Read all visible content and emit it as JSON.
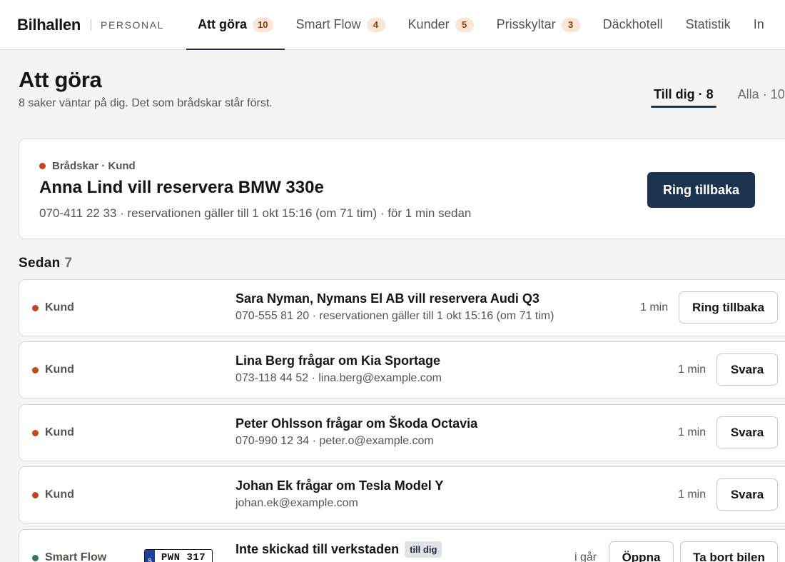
{
  "brand": {
    "name": "Bilhallen",
    "sub": "PERSONAL"
  },
  "nav": {
    "tabs": [
      {
        "label": "Att göra",
        "badge": "10",
        "active": true
      },
      {
        "label": "Smart Flow",
        "badge": "4"
      },
      {
        "label": "Kunder",
        "badge": "5"
      },
      {
        "label": "Prisskyltar",
        "badge": "3"
      },
      {
        "label": "Däckhotell"
      },
      {
        "label": "Statistik"
      },
      {
        "label": "In"
      }
    ]
  },
  "page": {
    "title": "Att göra",
    "subtitle": "8 saker väntar på dig. Det som brådskar står först."
  },
  "filters": [
    {
      "label": "Till dig · 8",
      "active": true
    },
    {
      "label": "Alla · 10"
    }
  ],
  "urgent": {
    "tag": "Brådskar · Kund",
    "title": "Anna Lind vill reservera BMW 330e",
    "meta": "070-411 22 33 · reservationen gäller till 1 okt 15:16 (om 71 tim) · för 1 min sedan",
    "action": "Ring tillbaka"
  },
  "section": {
    "label": "Sedan",
    "count": "7"
  },
  "rows": [
    {
      "tag": "Kund",
      "title": "Sara Nyman, Nymans El AB vill reservera Audi Q3",
      "meta": "070-555 81 20 · reservationen gäller till 1 okt 15:16 (om 71 tim)",
      "time": "1 min",
      "action": "Ring tillbaka"
    },
    {
      "tag": "Kund",
      "title": "Lina Berg frågar om Kia Sportage",
      "meta": "073-118 44 52 · lina.berg@example.com",
      "time": "1 min",
      "action": "Svara"
    },
    {
      "tag": "Kund",
      "title": "Peter Ohlsson frågar om Škoda Octavia",
      "meta": "070-990 12 34 · peter.o@example.com",
      "time": "1 min",
      "action": "Svara"
    },
    {
      "tag": "Kund",
      "title": "Johan Ek frågar om Tesla Model Y",
      "meta": "johan.ek@example.com",
      "time": "1 min",
      "action": "Svara"
    },
    {
      "tag": "Smart Flow",
      "plate": {
        "country": "S",
        "number": "PWN 317"
      },
      "title": "Inte skickad till verkstaden",
      "pill": "till dig",
      "time": "i går",
      "action": "Öppna",
      "action2": "Ta bort bilen"
    }
  ],
  "colors": {
    "primary": "#1c3450",
    "urgent_dot": "#c2451d",
    "smartflow_dot": "#2e7d4a",
    "badge_bg": "#fbe6d6"
  }
}
